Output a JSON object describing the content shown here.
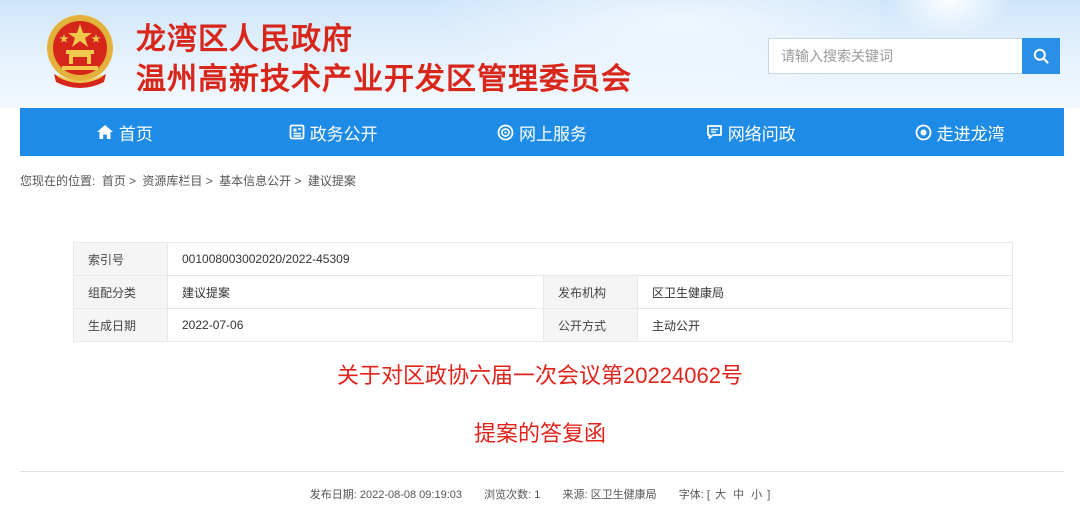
{
  "header": {
    "title_line1": "龙湾区人民政府",
    "title_line2": "温州高新技术产业开发区管理委员会",
    "emblem_icon": "national-emblem-icon"
  },
  "search": {
    "placeholder": "请输入搜索关键词",
    "button_icon": "search-icon"
  },
  "nav": {
    "items": [
      {
        "label": "首页",
        "icon": "home-icon"
      },
      {
        "label": "政务公开",
        "icon": "document-icon"
      },
      {
        "label": "网上服务",
        "icon": "service-icon"
      },
      {
        "label": "网络问政",
        "icon": "message-icon"
      },
      {
        "label": "走进龙湾",
        "icon": "eye-icon"
      }
    ]
  },
  "breadcrumb": {
    "prefix": "您现在的位置:",
    "items": [
      "首页",
      "资源库栏目",
      "基本信息公开",
      "建议提案"
    ],
    "separator": ">"
  },
  "info": {
    "index_label": "索引号",
    "index_value": "001008003002020/2022-45309",
    "category_label": "组配分类",
    "category_value": "建议提案",
    "publisher_label": "发布机构",
    "publisher_value": "区卫生健康局",
    "date_label": "生成日期",
    "date_value": "2022-07-06",
    "mode_label": "公开方式",
    "mode_value": "主动公开"
  },
  "article": {
    "title_line1": "关于对区政协六届一次会议第20224062号",
    "title_line2": "提案的答复函"
  },
  "meta": {
    "publish_label": "发布日期:",
    "publish_value": "2022-08-08 09:19:03",
    "views_label": "浏览次数:",
    "views_value": "1",
    "source_label": "来源:",
    "source_value": "区卫生健康局",
    "font_label": "字体:",
    "bracket_open": "[",
    "font_large": "大",
    "font_medium": "中",
    "font_small": "小",
    "bracket_close": "]"
  },
  "colors": {
    "accent_red": "#d8261b",
    "nav_blue": "#1e8ce6",
    "search_blue": "#2a8fe6"
  }
}
